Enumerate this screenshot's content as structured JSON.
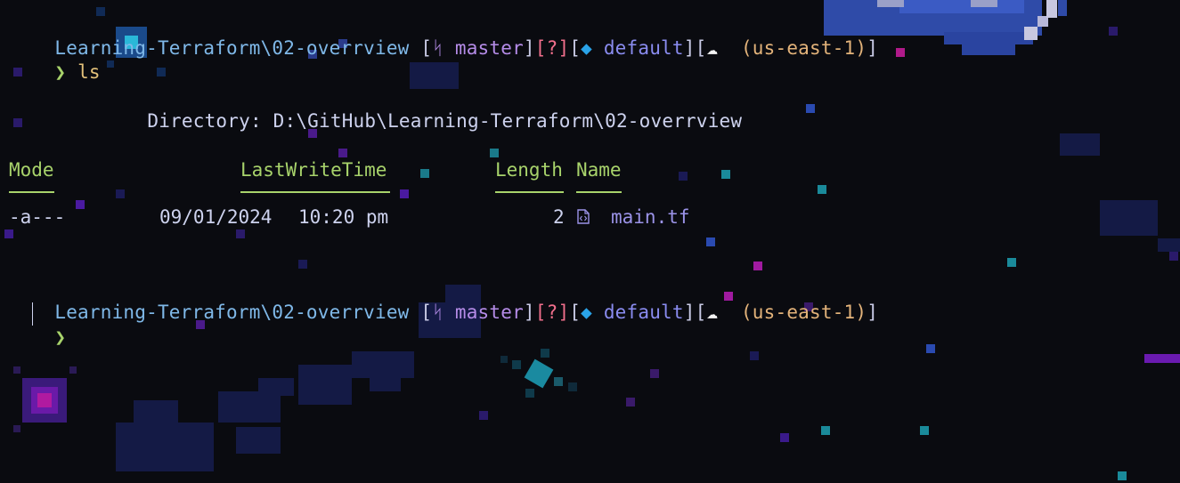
{
  "prompt": {
    "path": "Learning-Terraform\\02-overrview",
    "open_bracket": "[",
    "close_bracket": "]",
    "git_icon": "git-branch-icon",
    "git_glyph": "ᛋ",
    "branch": "master",
    "status": "[?]",
    "ws_icon": "terraform-diamond-icon",
    "ws_glyph": "◆",
    "workspace": "default",
    "cloud_icon": "cloud-icon",
    "cloud_glyph": "☁",
    "region": "(us-east-1)",
    "chevron": "❯"
  },
  "command": "ls",
  "directory": {
    "label": "Directory:",
    "path": "D:\\GitHub\\Learning-Terraform\\02-overrview"
  },
  "table": {
    "headers": [
      "Mode",
      "LastWriteTime",
      "Length",
      "Name"
    ],
    "rows": [
      {
        "mode": "-a---",
        "date": "09/01/2024",
        "time": "10:20 pm",
        "length": "2",
        "file_icon": "code-file-icon",
        "name": "main.tf"
      }
    ]
  },
  "colors": {
    "background": "#0a0b10",
    "path": "#7fb8e8",
    "branch": "#b58ce8",
    "status": "#f16f8c",
    "workspace": "#8a8cf0",
    "region": "#e3b37a",
    "header": "#a8d36b",
    "text": "#cdd2ee",
    "filename": "#9b93e8"
  }
}
